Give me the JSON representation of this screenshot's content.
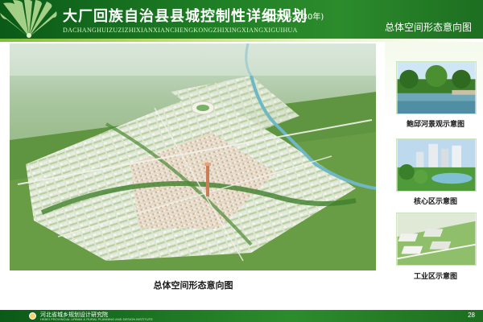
{
  "header": {
    "title": "大厂回族自治县县城控制性详细规划",
    "years": "(2014-2030年)",
    "pinyin": "DACHANGHUIZUZIZHIXIANXIANCHENGKONGZHIXINGXIANGXIGUIHUA",
    "section": "总体空间形态意向图"
  },
  "main": {
    "caption": "总体空间形态意向图"
  },
  "side": {
    "items": [
      {
        "caption": "鲍邱河景观示意图"
      },
      {
        "caption": "核心区示意图"
      },
      {
        "caption": "工业区示意图"
      }
    ]
  },
  "footer": {
    "org": "河北省城乡规划设计研究院",
    "org_en": "HEBEI PROVINCIAL URBAN & RURAL PLANNING AND DESIGN INSTITUTE",
    "page": "28"
  },
  "colors": {
    "brand_green": "#1f7f25",
    "light_green": "#b8dd6a"
  }
}
